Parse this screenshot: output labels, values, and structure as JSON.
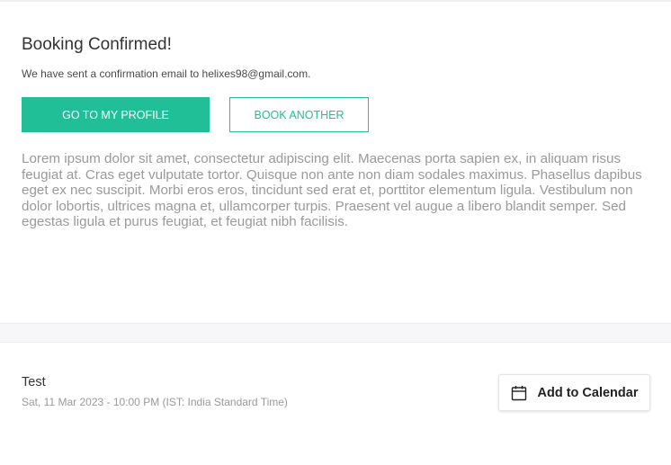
{
  "confirmation": {
    "title": "Booking Confirmed!",
    "subtitle": "We have sent a confirmation email to helixes98@gmail.com.",
    "primary_button": "GO TO MY PROFILE",
    "secondary_button": "BOOK ANOTHER",
    "body_text": "Lorem ipsum dolor sit amet, consectetur adipiscing elit. Maecenas porta sapien ex, in aliquam risus feugiat at. Cras eget vulputate tortor. Quisque non ante non diam sodales maximus. Phasellus dapibus eget ex nec suscipit. Morbi eros eros, tincidunt sed erat et, porttitor elementum ligula. Vestibulum non dolor lobortis, ultrices magna et, ullamcorper turpis. Praesent vel augue a libero blandit semper. Sed egestas ligula et purus feugiat, et feugiat nibh facilisis."
  },
  "event": {
    "name": "Test",
    "datetime": "Sat, 11 Mar 2023 - 10:00 PM (IST: India Standard Time)",
    "calendar_button": "Add to Calendar",
    "calendar_icon": "calendar-icon"
  },
  "colors": {
    "accent": "#21bf97",
    "muted_text": "#9a9a9a",
    "heading_text": "#333333"
  }
}
